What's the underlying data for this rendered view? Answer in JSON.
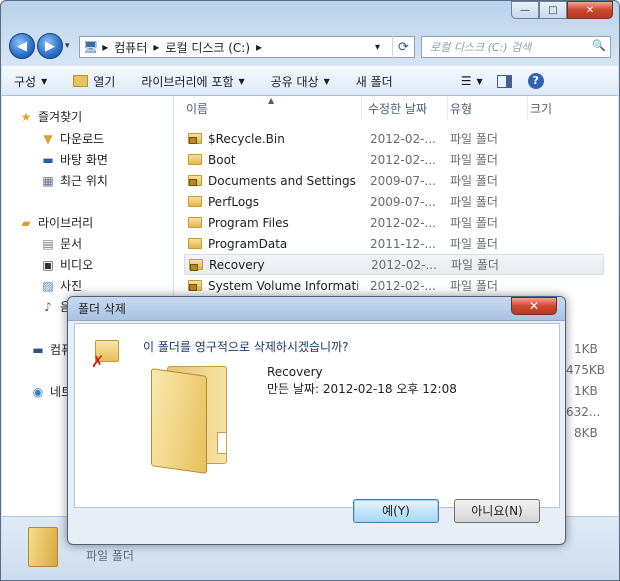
{
  "window": {
    "minimize_glyph": "—",
    "maximize_glyph": "□",
    "close_glyph": "✕"
  },
  "address": {
    "crumbs": [
      "▸",
      "컴퓨터",
      "▸",
      "로컬 디스크 (C:)",
      "▸"
    ],
    "dropdown_glyph": "▾",
    "refresh_glyph": "⟳"
  },
  "search": {
    "placeholder": "로컬 디스크 (C:) 검색",
    "icon": "search-icon"
  },
  "toolbar": {
    "organize": "구성",
    "open": "열기",
    "include_library": "라이브러리에 포함",
    "share_with": "공유 대상",
    "new_folder": "새 폴더"
  },
  "nav": {
    "favorites": "즐겨찾기",
    "downloads": "다운로드",
    "desktop": "바탕 화면",
    "recent": "최근 위치",
    "libraries": "라이브러리",
    "documents": "문서",
    "videos": "비디오",
    "pictures": "사진",
    "music": "음",
    "computer": "컴퓨",
    "network": "네트"
  },
  "columns": {
    "name": "이름",
    "modified": "수정한 날짜",
    "type": "유형",
    "size": "크기"
  },
  "files": [
    {
      "name": "$Recycle.Bin",
      "date": "2012-02-...",
      "type": "파일 폴더",
      "locked": true
    },
    {
      "name": "Boot",
      "date": "2012-02-...",
      "type": "파일 폴더",
      "locked": false
    },
    {
      "name": "Documents and Settings",
      "date": "2009-07-...",
      "type": "파일 폴더",
      "locked": true
    },
    {
      "name": "PerfLogs",
      "date": "2009-07-...",
      "type": "파일 폴더",
      "locked": false
    },
    {
      "name": "Program Files",
      "date": "2012-02-...",
      "type": "파일 폴더",
      "locked": false
    },
    {
      "name": "ProgramData",
      "date": "2011-12-...",
      "type": "파일 폴더",
      "locked": false
    },
    {
      "name": "Recovery",
      "date": "2012-02-...",
      "type": "파일 폴더",
      "locked": true
    },
    {
      "name": "System Volume Informati...",
      "date": "2012-02-...",
      "type": "파일 폴더",
      "locked": true
    }
  ],
  "partial_sizes": [
    "1KB",
    "475KB",
    "1KB",
    "632...",
    "8KB"
  ],
  "status": {
    "type_label": "파일 폴더"
  },
  "dialog": {
    "title": "폴더 삭제",
    "close_glyph": "✕",
    "question": "이 폴더를 영구적으로 삭제하시겠습니까?",
    "folder_name": "Recovery",
    "created": "만든 날짜: 2012-02-18 오후 12:08",
    "yes": "예(Y)",
    "no": "아니요(N)"
  }
}
